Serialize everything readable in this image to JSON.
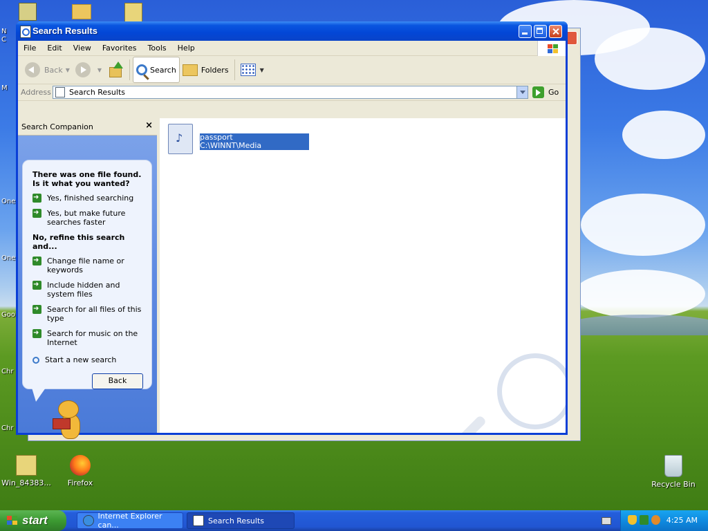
{
  "desktop": {
    "icons": [
      {
        "label": "Win_84383...",
        "icon": "zip-folder-icon"
      },
      {
        "label": "Firefox",
        "icon": "firefox-icon"
      },
      {
        "label": "Recycle Bin",
        "icon": "recycle-bin-icon"
      }
    ],
    "edge_labels": [
      "N",
      "C",
      "M",
      "One",
      "One",
      "Goo",
      "Chr",
      "Chr"
    ]
  },
  "window": {
    "title": "Search Results",
    "menu": [
      "File",
      "Edit",
      "View",
      "Favorites",
      "Tools",
      "Help"
    ],
    "toolbar": {
      "back": "Back",
      "search": "Search",
      "folders": "Folders"
    },
    "address": {
      "label": "Address",
      "value": "Search Results",
      "go": "Go"
    }
  },
  "companion": {
    "header": "Search Companion",
    "close": "×",
    "question": "There was one file found.  Is it what you wanted?",
    "yes_options": [
      "Yes, finished searching",
      "Yes, but make future searches faster"
    ],
    "refine_heading": "No, refine this search and...",
    "refine_options": [
      "Change file name or keywords",
      "Include hidden and system files",
      "Search for all files of this type",
      "Search for music on the Internet"
    ],
    "new_search": "Start a new search",
    "back_button": "Back"
  },
  "results": {
    "items": [
      {
        "name": "passport",
        "folder": "C:\\WINNT\\Media",
        "icon": "audio-file-icon"
      }
    ]
  },
  "taskbar": {
    "start": "start",
    "tasks": [
      "Internet Explorer can...",
      "Search Results"
    ],
    "clock": "4:25 AM"
  },
  "colors": {
    "title_blue": "#0a56e0",
    "selection": "#316ac5",
    "start_green": "#3c9a32",
    "tray_blue": "#0f8be0"
  }
}
